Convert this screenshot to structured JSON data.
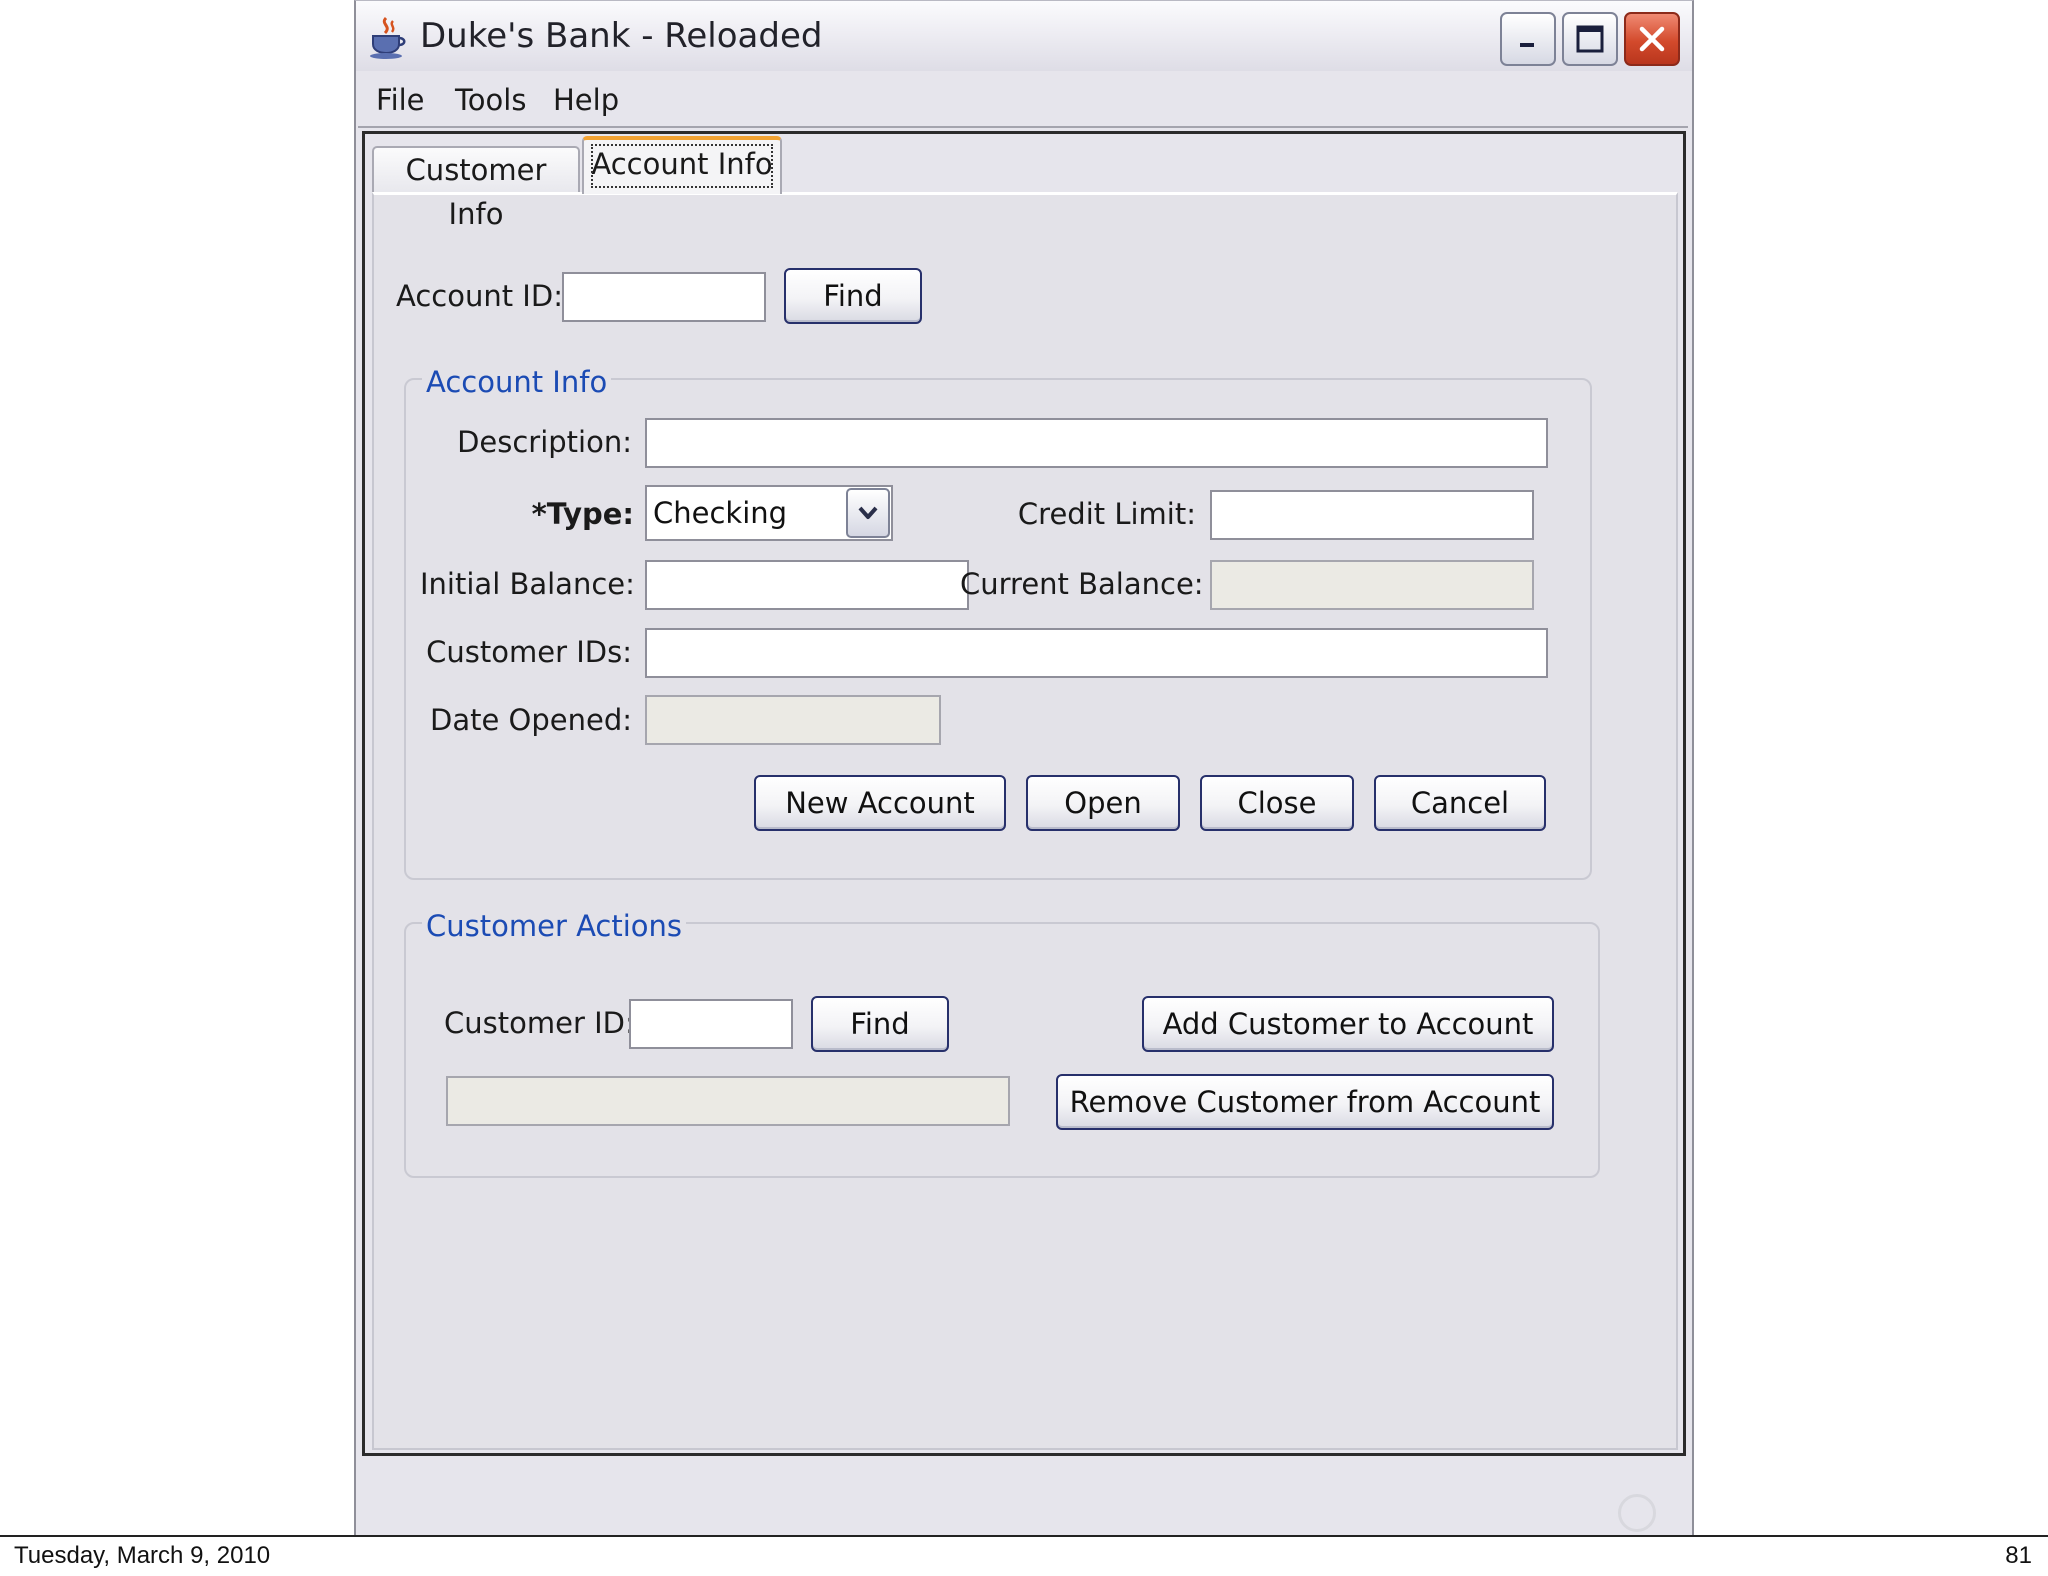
{
  "window": {
    "title": "Duke's Bank - Reloaded",
    "icon": "java-cup-icon"
  },
  "menu": [
    "File",
    "Tools",
    "Help"
  ],
  "tabs": [
    {
      "label": "Customer Info",
      "selected": false
    },
    {
      "label": "Account Info",
      "selected": true
    }
  ],
  "search": {
    "account_id_label": "Account ID:",
    "account_id_value": "",
    "find_label": "Find"
  },
  "account_info": {
    "group_title": "Account Info",
    "description_label": "Description:",
    "description_value": "",
    "type_label": "*Type:",
    "type_value": "Checking",
    "credit_limit_label": "Credit Limit:",
    "credit_limit_value": "",
    "initial_balance_label": "Initial Balance:",
    "initial_balance_value": "",
    "current_balance_label": "Current Balance:",
    "current_balance_value": "",
    "customer_ids_label": "Customer IDs:",
    "customer_ids_value": "",
    "date_opened_label": "Date Opened:",
    "date_opened_value": "",
    "buttons": {
      "new_account": "New Account",
      "open": "Open",
      "close": "Close",
      "cancel": "Cancel"
    }
  },
  "customer_actions": {
    "group_title": "Customer Actions",
    "customer_id_label": "Customer ID:",
    "customer_id_value": "",
    "find_label": "Find",
    "result_value": "",
    "add_label": "Add Customer to Account",
    "remove_label": "Remove Customer from Account"
  },
  "footer": {
    "date": "Tuesday, March 9, 2010",
    "page": "81"
  },
  "colors": {
    "group_title": "#1b4bb4",
    "tab_focus_accent": "#f1a232",
    "close_button": "#d34a2c"
  }
}
